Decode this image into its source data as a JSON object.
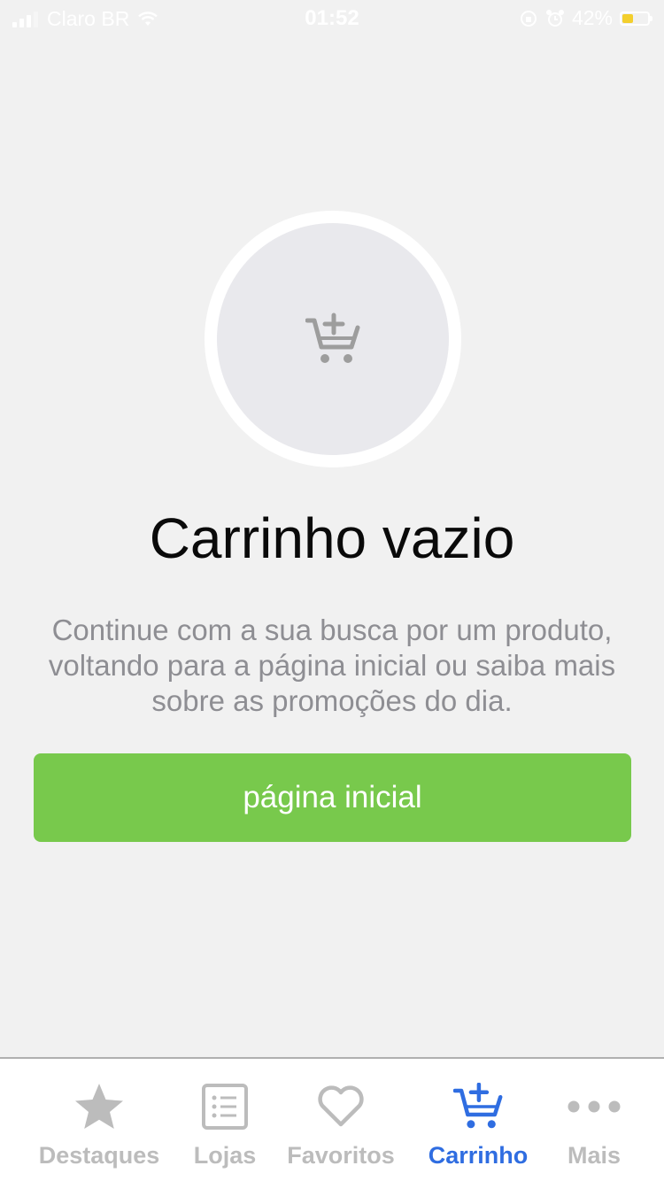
{
  "status_bar": {
    "carrier": "Claro BR",
    "time": "01:52",
    "battery_percent": "42%",
    "battery_level": 0.42,
    "signal_bars": 3
  },
  "empty_cart": {
    "icon": "cart-plus-icon",
    "title": "Carrinho vazio",
    "description": "Continue com a sua busca por um produto, voltando para a página inicial ou saiba mais sobre as promoções do dia.",
    "button_label": "página inicial"
  },
  "tab_bar": {
    "tabs": [
      {
        "label": "Destaques",
        "icon": "star-icon",
        "active": false
      },
      {
        "label": "Lojas",
        "icon": "list-icon",
        "active": false
      },
      {
        "label": "Favoritos",
        "icon": "heart-icon",
        "active": false
      },
      {
        "label": "Carrinho",
        "icon": "cart-plus-icon",
        "active": true
      },
      {
        "label": "Mais",
        "icon": "more-dots-icon",
        "active": false
      }
    ]
  },
  "colors": {
    "background": "#f1f1f1",
    "button": "#78c94c",
    "active_tab": "#2f6de1",
    "inactive_tab": "#bcbcbc",
    "battery": "#f3cf2d"
  }
}
